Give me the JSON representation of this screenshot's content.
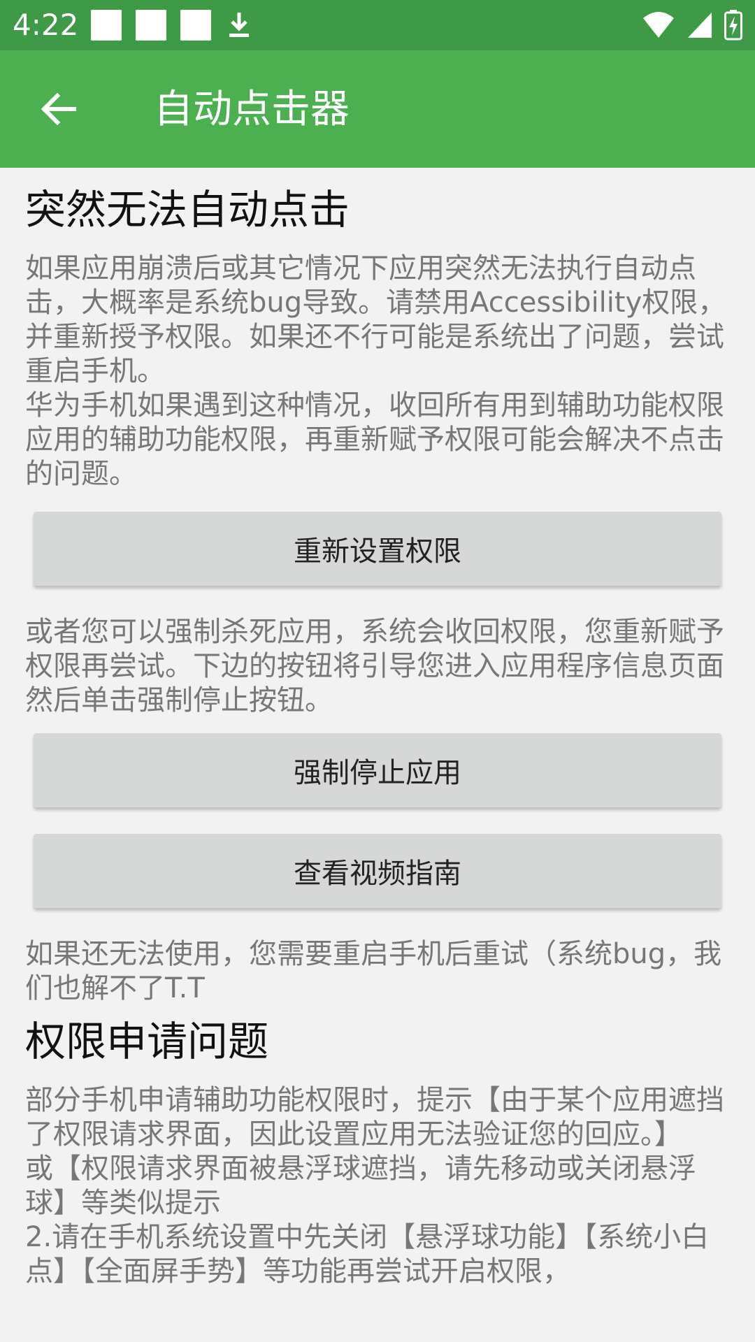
{
  "status_bar": {
    "time": "4:22",
    "bg_color": "#3F9A47",
    "icons": [
      "notification-square-icon",
      "notification-square-icon",
      "notification-square-icon",
      "download-icon",
      "wifi-icon",
      "signal-icon",
      "battery-charging-icon"
    ]
  },
  "app_bar": {
    "title": "自动点击器",
    "back_icon": "arrow-back-icon",
    "bg_color": "#4CAF50"
  },
  "sections": [
    {
      "title": "突然无法自动点击",
      "paragraph1": "如果应用崩溃后或其它情况下应用突然无法执行自动点击，大概率是系统bug导致。请禁用Accessibility权限，并重新授予权限。如果还不行可能是系统出了问题，尝试重启手机。\n华为手机如果遇到这种情况，收回所有用到辅助功能权限应用的辅助功能权限，再重新赋予权限可能会解决不点击的问题。",
      "reset_permission_button": "重新设置权限",
      "paragraph2": "或者您可以强制杀死应用，系统会收回权限，您重新赋予权限再尝试。下边的按钮将引导您进入应用程序信息页面然后单击强制停止按钮。",
      "force_stop_button": "强制停止应用",
      "video_guide_button": "查看视频指南",
      "paragraph3": "如果还无法使用，您需要重启手机后重试（系统bug，我们也解不了T.T"
    },
    {
      "title": "权限申请问题",
      "paragraph1": "部分手机申请辅助功能权限时，提示【由于某个应用遮挡了权限请求界面，因此设置应用无法验证您的回应。】\n或【权限请求界面被悬浮球遮挡，请先移动或关闭悬浮球】等类似提示\n2.请在手机系统设置中先关闭【悬浮球功能】【系统小白点】【全面屏手势】等功能再尝试开启权限，"
    }
  ]
}
